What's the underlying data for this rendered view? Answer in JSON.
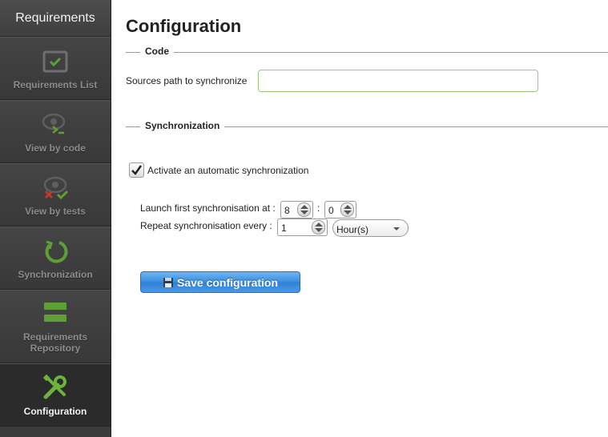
{
  "sidebar": {
    "title": "Requirements",
    "items": [
      {
        "label": "Requirements List",
        "icon": "checklist-icon",
        "active": false
      },
      {
        "label": "View by code",
        "icon": "eye-code-icon",
        "active": false
      },
      {
        "label": "View by tests",
        "icon": "eye-tests-icon",
        "active": false
      },
      {
        "label": "Synchronization",
        "icon": "sync-icon",
        "active": false
      },
      {
        "label": "Requirements Repository",
        "icon": "repository-icon",
        "active": false
      },
      {
        "label": "Configuration",
        "icon": "wrench-screwdriver-icon",
        "active": true
      }
    ]
  },
  "main": {
    "title": "Configuration",
    "code_section": {
      "legend": "Code",
      "sources_label": "Sources path to synchronize",
      "sources_value": ""
    },
    "sync_section": {
      "legend": "Synchronization",
      "auto_label": "Activate an automatic synchronization",
      "auto_checked": true,
      "launch_label": "Launch first synchronisation at :",
      "launch_hour": "8",
      "time_separator": ":",
      "launch_minute": "0",
      "repeat_label": "Repeat synchronisation every :",
      "repeat_value": "1",
      "repeat_unit": "Hour(s)"
    },
    "save_label": "Save configuration"
  },
  "colors": {
    "sidebar_bg": "#3b3b3b",
    "icon_green": "#6bb43a",
    "icon_red": "#d23a2a",
    "button_blue": "#3a8de0"
  }
}
